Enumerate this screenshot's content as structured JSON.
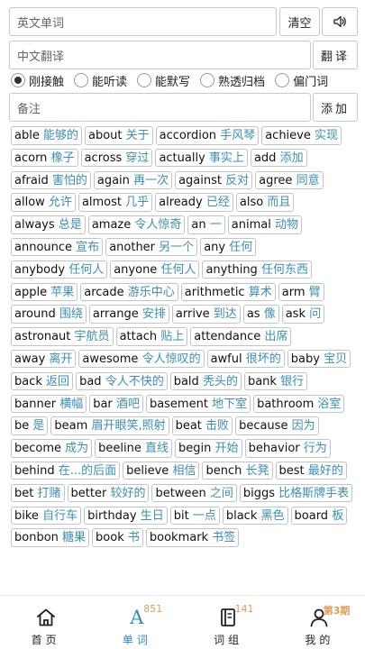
{
  "inputs": {
    "english_placeholder": "英文单词",
    "clear_label": "清空",
    "speaker_icon": "speaker-icon",
    "chinese_placeholder": "中文翻译",
    "translate_label": "翻译",
    "note_placeholder": "备注",
    "add_label": "添加"
  },
  "levels": [
    {
      "label": "刚接触",
      "selected": true
    },
    {
      "label": "能听读",
      "selected": false
    },
    {
      "label": "能默写",
      "selected": false
    },
    {
      "label": "熟透归档",
      "selected": false
    },
    {
      "label": "偏门词",
      "selected": false
    }
  ],
  "words": [
    {
      "en": "able",
      "cn": "能够的"
    },
    {
      "en": "about",
      "cn": "关于"
    },
    {
      "en": "accordion",
      "cn": "手风琴"
    },
    {
      "en": "achieve",
      "cn": "实现"
    },
    {
      "en": "acorn",
      "cn": "橡子"
    },
    {
      "en": "across",
      "cn": "穿过"
    },
    {
      "en": "actually",
      "cn": "事实上"
    },
    {
      "en": "add",
      "cn": "添加"
    },
    {
      "en": "afraid",
      "cn": "害怕的"
    },
    {
      "en": "again",
      "cn": "再一次"
    },
    {
      "en": "against",
      "cn": "反对"
    },
    {
      "en": "agree",
      "cn": "同意"
    },
    {
      "en": "allow",
      "cn": "允许"
    },
    {
      "en": "almost",
      "cn": "几乎"
    },
    {
      "en": "already",
      "cn": "已经"
    },
    {
      "en": "also",
      "cn": "而且"
    },
    {
      "en": "always",
      "cn": "总是"
    },
    {
      "en": "amaze",
      "cn": "令人惊奇"
    },
    {
      "en": "an",
      "cn": "一"
    },
    {
      "en": "animal",
      "cn": "动物"
    },
    {
      "en": "announce",
      "cn": "宣布"
    },
    {
      "en": "another",
      "cn": "另一个"
    },
    {
      "en": "any",
      "cn": "任何"
    },
    {
      "en": "anybody",
      "cn": "任何人"
    },
    {
      "en": "anyone",
      "cn": "任何人"
    },
    {
      "en": "anything",
      "cn": "任何东西"
    },
    {
      "en": "apple",
      "cn": "苹果"
    },
    {
      "en": "arcade",
      "cn": "游乐中心"
    },
    {
      "en": "arithmetic",
      "cn": "算术"
    },
    {
      "en": "arm",
      "cn": "臂"
    },
    {
      "en": "around",
      "cn": "围绕"
    },
    {
      "en": "arrange",
      "cn": "安排"
    },
    {
      "en": "arrive",
      "cn": "到达"
    },
    {
      "en": "as",
      "cn": "像"
    },
    {
      "en": "ask",
      "cn": "问"
    },
    {
      "en": "astronaut",
      "cn": "宇航员"
    },
    {
      "en": "attach",
      "cn": "贴上"
    },
    {
      "en": "attendance",
      "cn": "出席"
    },
    {
      "en": "away",
      "cn": "离开"
    },
    {
      "en": "awesome",
      "cn": "令人惊叹的"
    },
    {
      "en": "awful",
      "cn": "很坏的"
    },
    {
      "en": "baby",
      "cn": "宝贝"
    },
    {
      "en": "back",
      "cn": "返回"
    },
    {
      "en": "bad",
      "cn": "令人不快的"
    },
    {
      "en": "bald",
      "cn": "秃头的"
    },
    {
      "en": "bank",
      "cn": "银行"
    },
    {
      "en": "banner",
      "cn": "横幅"
    },
    {
      "en": "bar",
      "cn": "酒吧"
    },
    {
      "en": "basement",
      "cn": "地下室"
    },
    {
      "en": "bathroom",
      "cn": "浴室"
    },
    {
      "en": "be",
      "cn": "是"
    },
    {
      "en": "beam",
      "cn": "眉开眼笑,照射"
    },
    {
      "en": "beat",
      "cn": "击败"
    },
    {
      "en": "because",
      "cn": "因为"
    },
    {
      "en": "become",
      "cn": "成为"
    },
    {
      "en": "beeline",
      "cn": "直线"
    },
    {
      "en": "begin",
      "cn": "开始"
    },
    {
      "en": "behavior",
      "cn": "行为"
    },
    {
      "en": "behind",
      "cn": "在...的后面"
    },
    {
      "en": "believe",
      "cn": "相信"
    },
    {
      "en": "bench",
      "cn": "长凳"
    },
    {
      "en": "best",
      "cn": "最好的"
    },
    {
      "en": "bet",
      "cn": "打赌"
    },
    {
      "en": "better",
      "cn": "较好的"
    },
    {
      "en": "between",
      "cn": "之间"
    },
    {
      "en": "biggs",
      "cn": "比格斯牌手表"
    },
    {
      "en": "bike",
      "cn": "自行车"
    },
    {
      "en": "birthday",
      "cn": "生日"
    },
    {
      "en": "bit",
      "cn": "一点"
    },
    {
      "en": "black",
      "cn": "黑色"
    },
    {
      "en": "board",
      "cn": "板"
    },
    {
      "en": "bonbon",
      "cn": "糖果"
    },
    {
      "en": "book",
      "cn": "书"
    },
    {
      "en": "bookmark",
      "cn": "书签"
    }
  ],
  "tabs": {
    "home_label": "首页",
    "words_label": "单词",
    "words_count": "851",
    "phrases_label": "词组",
    "phrases_count": "141",
    "me_label": "我的",
    "me_badge": "第3期"
  },
  "colors": {
    "accent": "#2f8cc1",
    "chinese_text": "#3b8fb5",
    "badge": "#e39a55"
  }
}
